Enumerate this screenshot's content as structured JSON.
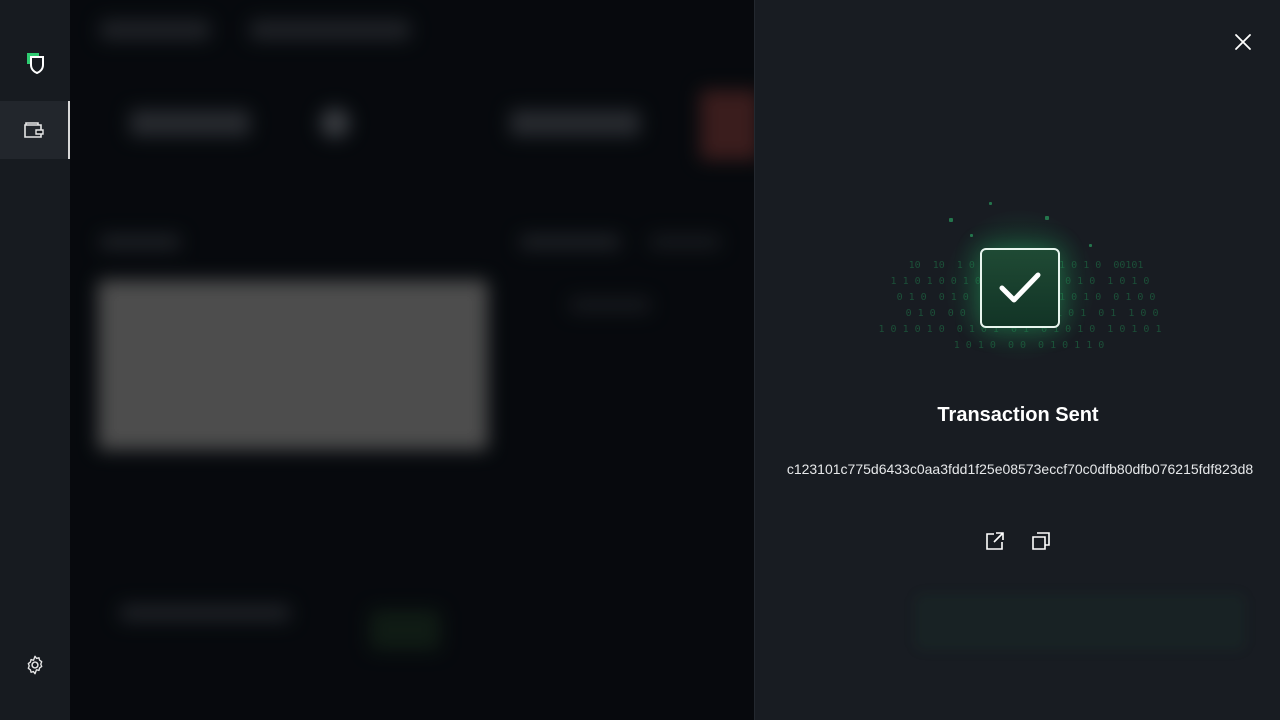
{
  "rail": {
    "items": [
      {
        "id": "logo",
        "icon": "shield-logo-icon"
      },
      {
        "id": "wallet",
        "icon": "wallet-icon",
        "active": true
      },
      {
        "id": "settings",
        "icon": "gear-icon"
      }
    ]
  },
  "drawer": {
    "close_icon": "close-icon",
    "status_icon": "check-icon",
    "title": "Transaction Sent",
    "tx_hash": "c123101c775d6433c0aa3fdd1f25e08573eccf70c0dfb80dfb076215fdf823d8",
    "actions": [
      {
        "id": "open-explorer",
        "icon": "external-link-icon"
      },
      {
        "id": "copy-hash",
        "icon": "copy-icon"
      }
    ]
  },
  "colors": {
    "accent_green": "#2ecc71",
    "drawer_bg": "#181c22",
    "rail_bg": "#171b20"
  }
}
